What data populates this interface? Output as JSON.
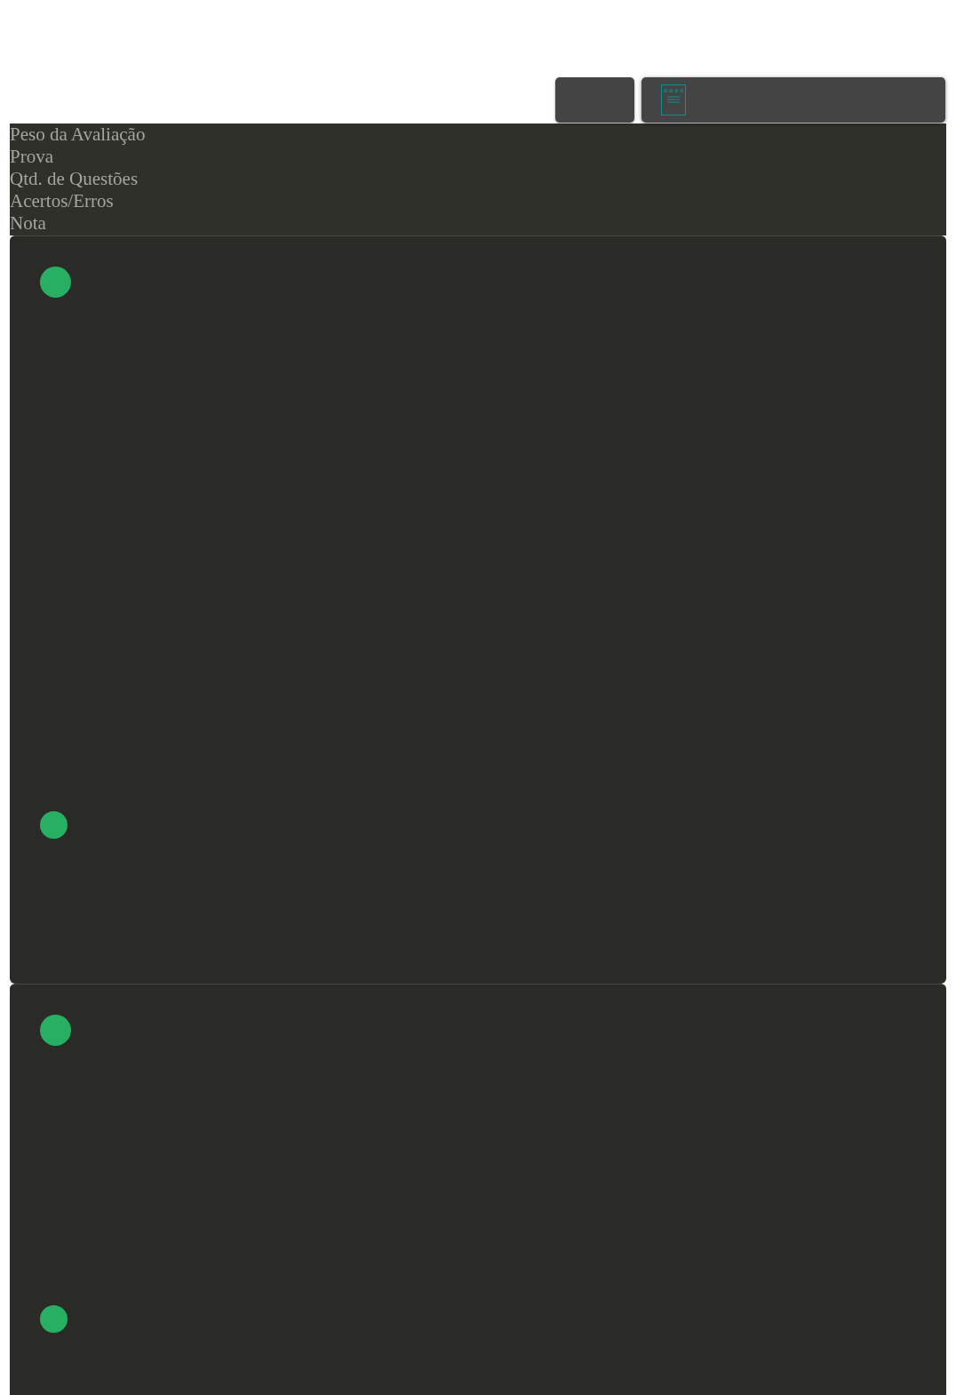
{
  "header": {
    "labels": [
      "Peso da Avaliação",
      "Prova",
      "Qtd. de Questões",
      "Acertos/Erros",
      "Nota"
    ]
  },
  "cards": [
    {
      "markers": [
        {
          "color": "#27b064"
        },
        {
          "color": "#27b064"
        }
      ]
    },
    {
      "markers": [
        {
          "color": "#27b064"
        },
        {
          "color": "#27b064"
        }
      ]
    }
  ]
}
